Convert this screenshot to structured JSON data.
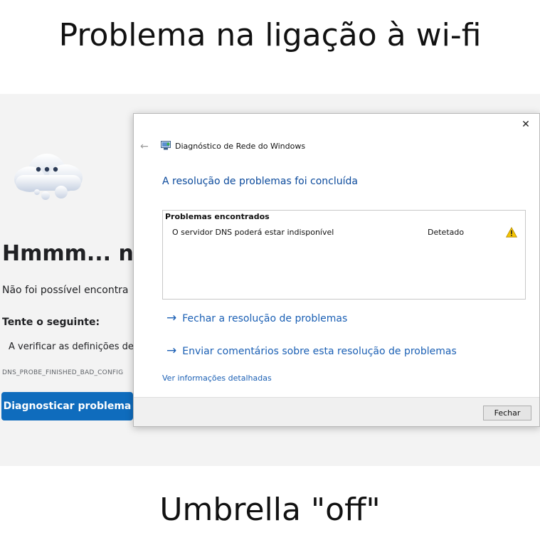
{
  "meme": {
    "top_caption": "Problema na ligação à wi-fi",
    "bottom_caption": "Umbrella \"off\""
  },
  "browser_error": {
    "title": "Hmmm... não",
    "subtitle": "Não foi possível encontra",
    "try_heading": "Tente o seguinte:",
    "bullet": "A verificar as definições de p",
    "error_code": "DNS_PROBE_FINISHED_BAD_CONFIG",
    "diagnose_button": "Diagnosticar problema",
    "accent": "#0f6cbd"
  },
  "dialog": {
    "title": "Diagnóstico de Rede do Windows",
    "heading": "A resolução de problemas foi concluída",
    "problems": {
      "header": "Problemas encontrados",
      "items": [
        {
          "description": "O servidor DNS poderá estar indisponível",
          "status": "Detetado",
          "icon": "warning-icon"
        }
      ]
    },
    "links": [
      {
        "label": "Fechar a resolução de problemas"
      },
      {
        "label": "Enviar comentários sobre esta resolução de problemas"
      }
    ],
    "details_link": "Ver informações detalhadas",
    "close_button": "Fechar",
    "link_color": "#1a5fb4",
    "heading_color": "#0b4a9c"
  }
}
